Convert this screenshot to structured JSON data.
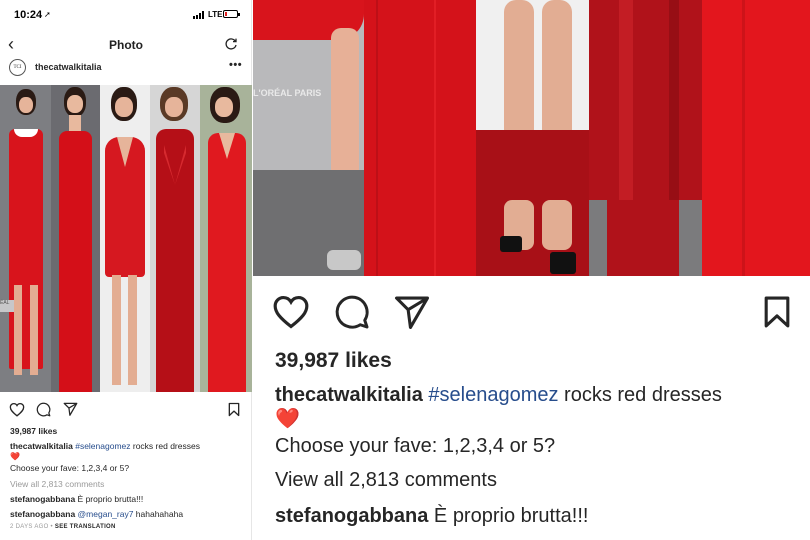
{
  "status_bar": {
    "time": "10:24",
    "network": "LTE",
    "battery_level": 0.2,
    "location_arrow": "➚"
  },
  "navbar": {
    "title": "Photo",
    "back_icon": "‹",
    "refresh_icon": "refresh-icon"
  },
  "post": {
    "username": "thecatwalkitalia",
    "avatar_text": "TCI",
    "more_icon": "•••",
    "likes": "39,987 likes",
    "caption_hashtag": "#selenagomez",
    "caption_text": " rocks red dresses",
    "caption_emoji": "❤️",
    "caption_line2": "Choose your fave: 1,2,3,4 or 5?",
    "view_comments": "View all 2,813 comments",
    "comments": [
      {
        "user": "stefanogabbana",
        "text": " È proprio brutta!!!"
      },
      {
        "user": "stefanogabbana",
        "mention": " @megan_ray7",
        "text": " hahahahaha"
      }
    ],
    "timestamp": "2 DAYS AGO",
    "separator": " • ",
    "translation_link": "SEE TRANSLATION",
    "photo_caption_text": "L'ORÉAL PARIS"
  },
  "colors": {
    "dress_red": "#d8141c",
    "hashtag_blue": "#274d8c",
    "muted_gray": "#9a9a9a",
    "backdrop_gray": "#8c8c8e"
  }
}
